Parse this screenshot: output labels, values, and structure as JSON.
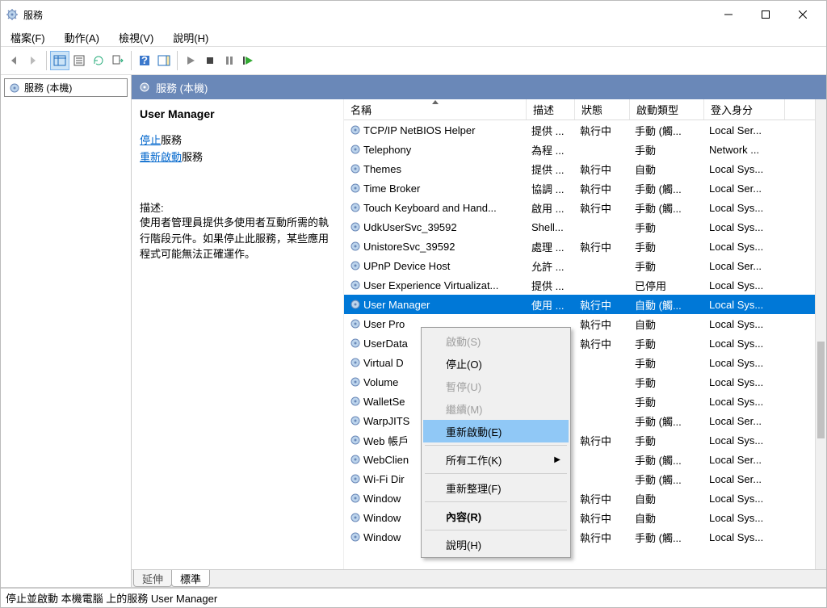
{
  "window": {
    "title": "服務"
  },
  "menubar": {
    "file": "檔案(F)",
    "action": "動作(A)",
    "view": "檢視(V)",
    "help": "說明(H)"
  },
  "left": {
    "node": "服務 (本機)"
  },
  "panelHeader": {
    "title": "服務 (本機)"
  },
  "detail": {
    "service_title": "User Manager",
    "stop_link": "停止",
    "after_stop": "服務",
    "restart_link": "重新啟動",
    "after_restart": "服務",
    "desc_label": "描述:",
    "desc_body": "使用者管理員提供多使用者互動所需的執行階段元件。如果停止此服務，某些應用程式可能無法正確運作。"
  },
  "columns": {
    "name": "名稱",
    "desc": "描述",
    "status": "狀態",
    "startup": "啟動類型",
    "logon": "登入身分"
  },
  "rows": [
    {
      "name": "TCP/IP NetBIOS Helper",
      "desc": "提供 ...",
      "status": "執行中",
      "startup": "手動 (觸...",
      "logon": "Local Ser..."
    },
    {
      "name": "Telephony",
      "desc": "為程 ...",
      "status": "",
      "startup": "手動",
      "logon": "Network ..."
    },
    {
      "name": "Themes",
      "desc": "提供 ...",
      "status": "執行中",
      "startup": "自動",
      "logon": "Local Sys..."
    },
    {
      "name": "Time Broker",
      "desc": "協調 ...",
      "status": "執行中",
      "startup": "手動 (觸...",
      "logon": "Local Ser..."
    },
    {
      "name": "Touch Keyboard and Hand...",
      "desc": "啟用 ...",
      "status": "執行中",
      "startup": "手動 (觸...",
      "logon": "Local Sys..."
    },
    {
      "name": "UdkUserSvc_39592",
      "desc": "Shell...",
      "status": "",
      "startup": "手動",
      "logon": "Local Sys..."
    },
    {
      "name": "UnistoreSvc_39592",
      "desc": "處理 ...",
      "status": "執行中",
      "startup": "手動",
      "logon": "Local Sys..."
    },
    {
      "name": "UPnP Device Host",
      "desc": "允許 ...",
      "status": "",
      "startup": "手動",
      "logon": "Local Ser..."
    },
    {
      "name": "User Experience Virtualizat...",
      "desc": "提供 ...",
      "status": "",
      "startup": "已停用",
      "logon": "Local Sys..."
    },
    {
      "name": "User Manager",
      "desc": "使用 ...",
      "status": "執行中",
      "startup": "自動 (觸...",
      "logon": "Local Sys...",
      "sel": true
    },
    {
      "name": "User Pro",
      "desc": "",
      "status": "執行中",
      "startup": "自動",
      "logon": "Local Sys..."
    },
    {
      "name": "UserData",
      "desc": "",
      "status": "執行中",
      "startup": "手動",
      "logon": "Local Sys..."
    },
    {
      "name": "Virtual D",
      "desc": "",
      "status": "",
      "startup": "手動",
      "logon": "Local Sys..."
    },
    {
      "name": "Volume",
      "desc": "",
      "status": "",
      "startup": "手動",
      "logon": "Local Sys..."
    },
    {
      "name": "WalletSe",
      "desc": "",
      "status": "",
      "startup": "手動",
      "logon": "Local Sys..."
    },
    {
      "name": "WarpJITS",
      "desc": "",
      "status": "",
      "startup": "手動 (觸...",
      "logon": "Local Ser..."
    },
    {
      "name": "Web 帳戶",
      "desc": "",
      "status": "執行中",
      "startup": "手動",
      "logon": "Local Sys..."
    },
    {
      "name": "WebClien",
      "desc": "",
      "status": "",
      "startup": "手動 (觸...",
      "logon": "Local Ser..."
    },
    {
      "name": "Wi-Fi Dir",
      "desc": "",
      "status": "",
      "startup": "手動 (觸...",
      "logon": "Local Ser..."
    },
    {
      "name": "Window",
      "desc": "",
      "status": "執行中",
      "startup": "自動",
      "logon": "Local Sys..."
    },
    {
      "name": "Window",
      "desc": "",
      "status": "執行中",
      "startup": "自動",
      "logon": "Local Sys..."
    },
    {
      "name": "Window",
      "desc": "",
      "status": "執行中",
      "startup": "手動 (觸...",
      "logon": "Local Sys..."
    }
  ],
  "ctx": {
    "start": "啟動(S)",
    "stop": "停止(O)",
    "pause": "暫停(U)",
    "resume": "繼續(M)",
    "restart": "重新啟動(E)",
    "alltasks": "所有工作(K)",
    "refresh": "重新整理(F)",
    "properties": "內容(R)",
    "help": "說明(H)"
  },
  "tabs": {
    "extended": "延伸",
    "standard": "標準"
  },
  "statusbar": {
    "text": "停止並啟動 本機電腦 上的服務 User Manager"
  }
}
